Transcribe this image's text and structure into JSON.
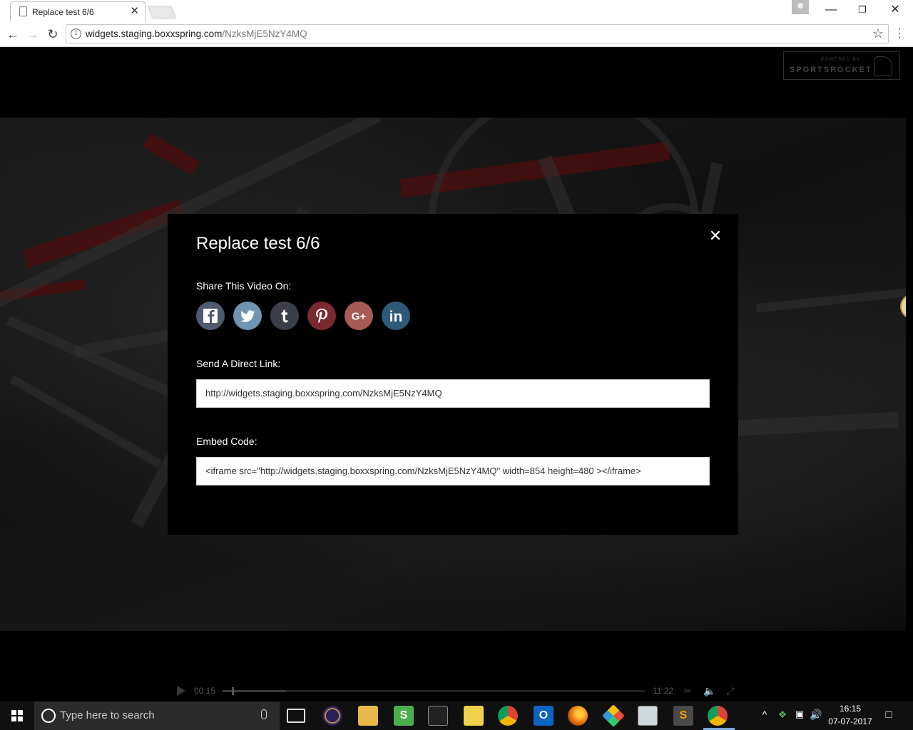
{
  "browser": {
    "tab_title": "Replace test 6/6",
    "url_host": "widgets.staging.boxxspring.com",
    "url_path": "/NzksMjE5NzY4MQ"
  },
  "logo": {
    "powered_by": "POWERED BY",
    "brand": "SPORTSROCKET"
  },
  "share_modal": {
    "title": "Replace test 6/6",
    "share_label": "Share This Video On:",
    "social": [
      {
        "name": "facebook",
        "color": "#3b5998"
      },
      {
        "name": "twitter",
        "color": "#55acee"
      },
      {
        "name": "tumblr",
        "color": "#35465c"
      },
      {
        "name": "pinterest",
        "color": "#cb2027"
      },
      {
        "name": "google-plus",
        "color": "#dd4b39"
      },
      {
        "name": "linkedin",
        "color": "#007bb5"
      }
    ],
    "direct_link_label": "Send A Direct Link:",
    "direct_link_value": "http://widgets.staging.boxxspring.com/NzksMjE5NzY4MQ",
    "embed_label": "Embed Code:",
    "embed_value": "<iframe src=\"http://widgets.staging.boxxspring.com/NzksMjE5NzY4MQ\" width=854 height=480 ></iframe>"
  },
  "player": {
    "current_time": "00:15",
    "duration": "11:22",
    "progress_fraction": 0.022,
    "buffered_fraction": 0.15
  },
  "taskbar": {
    "search_placeholder": "Type here to search",
    "time": "16:15",
    "date": "07-07-2017"
  }
}
